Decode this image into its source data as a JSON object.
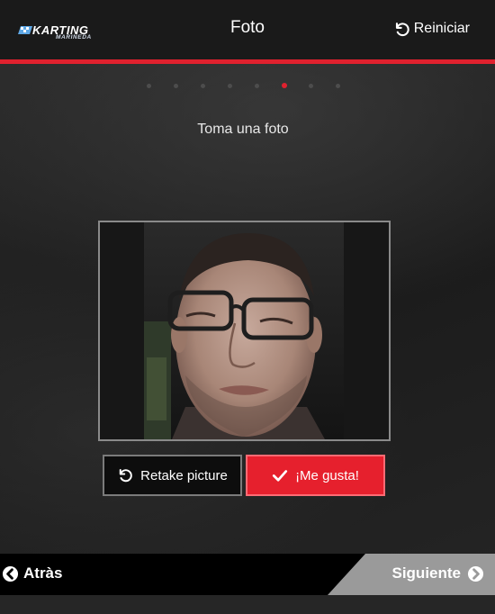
{
  "header": {
    "logo_main": "KARTING",
    "logo_sub": "MARINEDA",
    "title": "Foto",
    "reset_label": "Reiniciar"
  },
  "steps": {
    "total": 8,
    "active_index": 5
  },
  "prompt": "Toma una foto",
  "actions": {
    "retake_label": "Retake picture",
    "like_label": "¡Me gusta!"
  },
  "footer": {
    "back_label": "Atràs",
    "next_label": "Siguiente"
  },
  "colors": {
    "accent": "#e0212e",
    "header_bg": "#1a1a1a",
    "footer_next_bg": "#9a9a9a"
  },
  "icons": [
    "undo-icon",
    "check-icon",
    "chevron-left-circle-icon",
    "chevron-right-circle-icon"
  ]
}
